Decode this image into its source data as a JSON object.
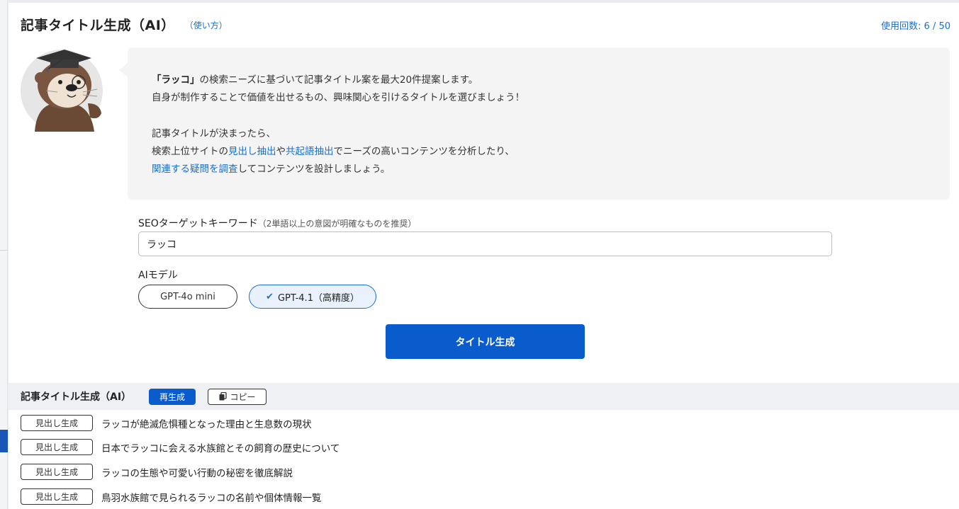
{
  "header": {
    "title": "記事タイトル生成（AI）",
    "howto_link": "（使い方）",
    "usage": "使用回数: 6 / 50"
  },
  "info": {
    "line1_keyword": "「ラッコ」",
    "line1_rest": "の検索ニーズに基づいて記事タイトル案を最大20件提案します。",
    "line2": "自身が制作することで価値を出せるもの、興味関心を引けるタイトルを選びましょう！",
    "line3": "記事タイトルが決まったら、",
    "line4_pre": "検索上位サイトの",
    "line4_link1": "見出し抽出",
    "line4_mid": "や",
    "line4_link2": "共起語抽出",
    "line4_post": "でニーズの高いコンテンツを分析したり、",
    "line5_link": "関連する疑問を調査",
    "line5_post": "してコンテンツを設計しましょう。"
  },
  "form": {
    "keyword_label": "SEOターゲットキーワード",
    "keyword_hint": "（2単語以上の意図が明確なものを推奨）",
    "keyword_value": "ラッコ",
    "model_label": "AIモデル",
    "model_options": [
      "GPT-4o mini",
      "GPT-4.1（高精度）"
    ],
    "model_selected": "GPT-4.1（高精度）",
    "generate_label": "タイトル生成"
  },
  "results": {
    "title": "記事タイトル生成（AI）",
    "regenerate_label": "再生成",
    "copy_label": "コピー",
    "row_button_label": "見出し生成",
    "items": [
      "ラッコが絶滅危惧種となった理由と生息数の現状",
      "日本でラッコに会える水族館とその飼育の歴史について",
      "ラッコの生態や可愛い行動の秘密を徹底解説",
      "鳥羽水族館で見られるラッコの名前や個体情報一覧"
    ]
  },
  "colors": {
    "accent": "#0a5ccd",
    "link": "#1a6fd0",
    "info_bg": "#f4f4f4",
    "results_bar_bg": "#eef0f3"
  },
  "icons": {
    "mascot": "otter-professor-mascot",
    "check": "check-icon",
    "copy": "copy-icon"
  }
}
